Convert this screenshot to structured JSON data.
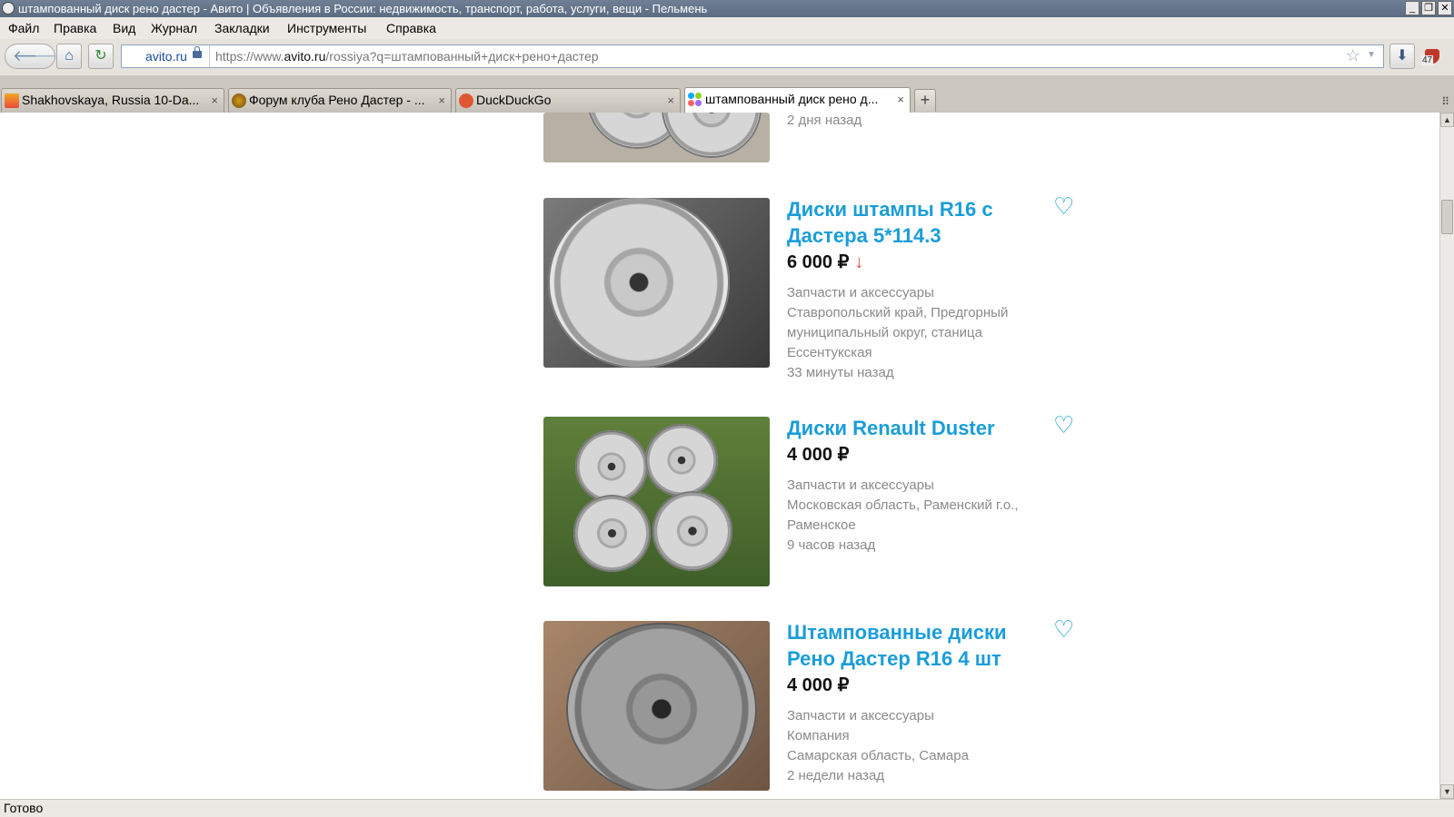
{
  "window": {
    "title": "штампованный диск рено дастер - Авито | Объявления в России: недвижимость, транспорт, работа, услуги, вещи - Пельмень"
  },
  "menu": [
    "Файл",
    "Правка",
    "Вид",
    "Журнал",
    "Закладки",
    "Инструменты",
    "Справка"
  ],
  "urlbar": {
    "identity_domain": "avito.ru",
    "url_prefix": "https://www.",
    "url_host": "avito.ru",
    "url_path": "/rossiya?q=штампованный+диск+рено+дастер"
  },
  "tabs": [
    {
      "label": "Shakhovskaya, Russia 10-Da...",
      "active": false
    },
    {
      "label": "Форум клуба Рено Дастер - ...",
      "active": false
    },
    {
      "label": "DuckDuckGo",
      "active": false
    },
    {
      "label": "штампованный диск рено д...",
      "active": true
    }
  ],
  "listings": {
    "prev": {
      "time": "2 дня назад"
    },
    "items": [
      {
        "title": "Диски штампы R16 с Дастера 5*114.3",
        "price": "6 000 ₽",
        "price_down_icon": "arrow-down",
        "category": "Запчасти и аксессуары",
        "location": "Ставропольский край, Предгорный муниципальный округ, станица Ессентукская",
        "time": "33 минуты назад"
      },
      {
        "title": "Диски Renault Duster",
        "price": "4 000 ₽",
        "category": "Запчасти и аксессуары",
        "location": "Московская область, Раменский г.о., Раменское",
        "time": "9 часов назад"
      },
      {
        "title": "Штампованные диски Рено Дастер R16 4 шт",
        "price": "4 000 ₽",
        "category": "Запчасти и аксессуары",
        "seller": "Компания",
        "location": "Самарская область, Самара",
        "time": "2 недели назад"
      }
    ]
  },
  "status": {
    "text": "Готово"
  },
  "toolbar_badge": "47",
  "colors": {
    "link": "#1a9dd9",
    "price_down": "#e34b4b"
  }
}
